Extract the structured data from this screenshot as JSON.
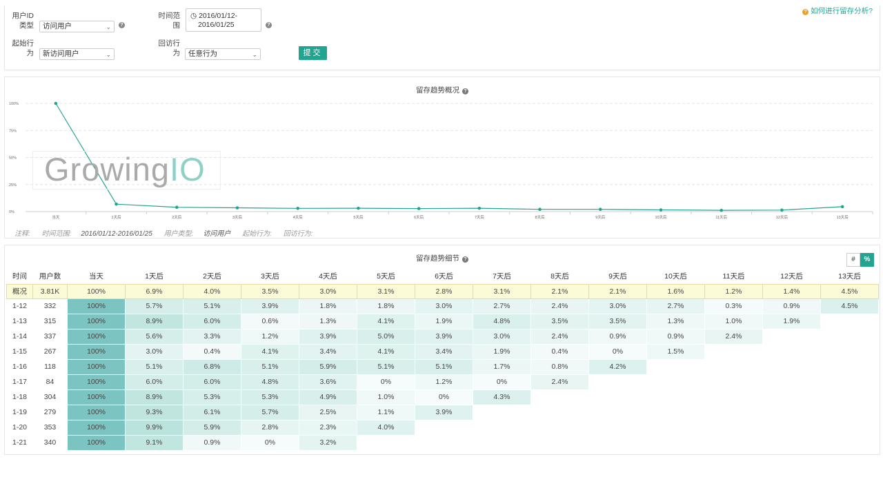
{
  "filters": {
    "user_id_type_label": "用户ID类型",
    "user_id_type_value": "访问用户",
    "start_action_label": "起始行为",
    "start_action_value": "新访问用户",
    "time_range_label": "时间范围",
    "time_range_line1": "2016/01/12-",
    "time_range_line2": "2016/01/25",
    "return_action_label": "回访行为",
    "return_action_value": "任意行为",
    "submit_label": "提交",
    "help_link": "如何进行留存分析?"
  },
  "chart_panel": {
    "title": "留存趋势概况",
    "watermark_text": "Growing",
    "watermark_suffix": "IO",
    "notes": {
      "label": "注释:",
      "time_label": "时间范围:",
      "time_value": "2016/01/12-2016/01/25",
      "user_type_label": "用户类型:",
      "user_type_value": "访问用户",
      "start_label": "起始行为:",
      "return_label": "回访行为:"
    }
  },
  "chart_data": {
    "type": "line",
    "categories": [
      "当天",
      "1天后",
      "2天后",
      "3天后",
      "4天后",
      "5天后",
      "6天后",
      "7天后",
      "8天后",
      "9天后",
      "10天后",
      "11天后",
      "12天后",
      "13天后"
    ],
    "series": [
      {
        "values": [
          100,
          6.9,
          4.0,
          3.5,
          3.0,
          3.1,
          2.8,
          3.1,
          2.1,
          2.1,
          1.6,
          1.2,
          1.4,
          4.5
        ]
      }
    ],
    "y_ticks": [
      "0%",
      "25%",
      "50%",
      "75%",
      "100%"
    ],
    "ylim": [
      0,
      100
    ],
    "grid": true,
    "color": "#22a590"
  },
  "table_panel": {
    "title": "留存趋势细节",
    "toggle_count": "#",
    "toggle_percent": "%",
    "headers": [
      "时间",
      "用户数",
      "当天",
      "1天后",
      "2天后",
      "3天后",
      "4天后",
      "5天后",
      "6天后",
      "7天后",
      "8天后",
      "9天后",
      "10天后",
      "11天后",
      "12天后",
      "13天后"
    ],
    "summary": [
      "概况",
      "3.81K",
      "100%",
      "6.9%",
      "4.0%",
      "3.5%",
      "3.0%",
      "3.1%",
      "2.8%",
      "3.1%",
      "2.1%",
      "2.1%",
      "1.6%",
      "1.2%",
      "1.4%",
      "4.5%"
    ],
    "rows": [
      [
        "1-12",
        "332",
        "100%",
        "5.7%",
        "5.1%",
        "3.9%",
        "1.8%",
        "1.8%",
        "3.0%",
        "2.7%",
        "2.4%",
        "3.0%",
        "2.7%",
        "0.3%",
        "0.9%",
        "4.5%"
      ],
      [
        "1-13",
        "315",
        "100%",
        "8.9%",
        "6.0%",
        "0.6%",
        "1.3%",
        "4.1%",
        "1.9%",
        "4.8%",
        "3.5%",
        "3.5%",
        "1.3%",
        "1.0%",
        "1.9%"
      ],
      [
        "1-14",
        "337",
        "100%",
        "5.6%",
        "3.3%",
        "1.2%",
        "3.9%",
        "5.0%",
        "3.9%",
        "3.0%",
        "2.4%",
        "0.9%",
        "0.9%",
        "2.4%"
      ],
      [
        "1-15",
        "267",
        "100%",
        "3.0%",
        "0.4%",
        "4.1%",
        "3.4%",
        "4.1%",
        "3.4%",
        "1.9%",
        "0.4%",
        "0%",
        "1.5%"
      ],
      [
        "1-16",
        "118",
        "100%",
        "5.1%",
        "6.8%",
        "5.1%",
        "5.9%",
        "5.1%",
        "5.1%",
        "1.7%",
        "0.8%",
        "4.2%"
      ],
      [
        "1-17",
        "84",
        "100%",
        "6.0%",
        "6.0%",
        "4.8%",
        "3.6%",
        "0%",
        "1.2%",
        "0%",
        "2.4%"
      ],
      [
        "1-18",
        "304",
        "100%",
        "8.9%",
        "5.3%",
        "5.3%",
        "4.9%",
        "1.0%",
        "0%",
        "4.3%"
      ],
      [
        "1-19",
        "279",
        "100%",
        "9.3%",
        "6.1%",
        "5.7%",
        "2.5%",
        "1.1%",
        "3.9%"
      ],
      [
        "1-20",
        "353",
        "100%",
        "9.9%",
        "5.9%",
        "2.8%",
        "2.3%",
        "4.0%"
      ],
      [
        "1-21",
        "340",
        "100%",
        "9.1%",
        "0.9%",
        "0%",
        "3.2%"
      ]
    ],
    "colors": {
      "accent": "#22a590",
      "day0_cell": "#7cc4c1",
      "summary_bg": "#fbfbd8"
    }
  }
}
